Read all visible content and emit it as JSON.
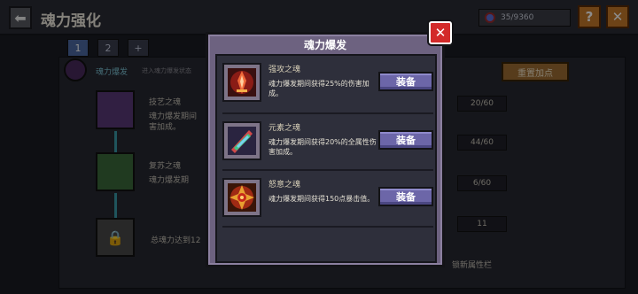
{
  "header": {
    "title": "魂力强化",
    "back_icon": "arrow-left-icon",
    "currency_value": "35/9360",
    "help_label": "?",
    "close_label": "✕"
  },
  "tabs": [
    {
      "label": "1",
      "active": true
    },
    {
      "label": "2",
      "active": false
    },
    {
      "label": "+",
      "active": false
    }
  ],
  "panel": {
    "burst_label": "魂力爆发",
    "burst_hint": "进入魂力爆发状态",
    "reset_label": "重置加点",
    "rows": [
      {
        "name": "技艺之魂",
        "desc1": "魂力爆发期间",
        "desc2": "害加成。",
        "progress": "20/60",
        "color": "#5a3a78"
      },
      {
        "name": "复苏之魂",
        "desc1": "魂力爆发期",
        "desc2": "",
        "progress": "44/60",
        "color": "#3b6b3b"
      },
      {
        "name": "",
        "desc1": "",
        "desc2": "",
        "progress": "6/60",
        "color": ""
      },
      {
        "name": "总魂力达到12",
        "desc1": "",
        "desc2": "",
        "progress": "11",
        "color": "#4a4a4a"
      }
    ],
    "unlock_hint": "锁新属性栏"
  },
  "dialog": {
    "title": "魂力爆发",
    "close_label": "✕",
    "items": [
      {
        "name": "强攻之魂",
        "desc": "魂力爆发期间获得25%的伤害加成。",
        "button": "装备",
        "icon": "strike-soul-icon",
        "color": "#c23a2a"
      },
      {
        "name": "元素之魂",
        "desc": "魂力爆发期间获得20%的全属性伤害加成。",
        "button": "装备",
        "icon": "element-soul-icon",
        "color": "#3aa86a"
      },
      {
        "name": "怒意之魂",
        "desc": "魂力爆发期间获得150点暴击值。",
        "button": "装备",
        "icon": "rage-soul-icon",
        "color": "#d4a028"
      }
    ]
  }
}
